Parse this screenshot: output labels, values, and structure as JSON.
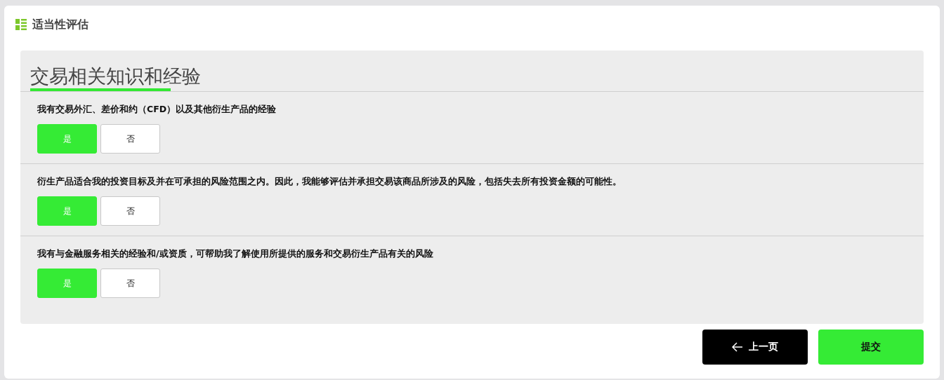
{
  "header": {
    "title": "适当性评估"
  },
  "section": {
    "title": "交易相关知识和经验",
    "questions": [
      {
        "text": "我有交易外汇、差价和约（CFD）以及其他衍生产品的经验",
        "options": [
          {
            "label": "是",
            "selected": true
          },
          {
            "label": "否",
            "selected": false
          }
        ]
      },
      {
        "text": "衍生产品适合我的投资目标及并在可承担的风险范围之内。因此，我能够评估并承担交易该商品所涉及的风险，包括失去所有投资金额的可能性。",
        "options": [
          {
            "label": "是",
            "selected": true
          },
          {
            "label": "否",
            "selected": false
          }
        ]
      },
      {
        "text": "我有与金融服务相关的经验和/或资质，可帮助我了解使用所提供的服务和交易衍生产品有关的风险",
        "options": [
          {
            "label": "是",
            "selected": true
          },
          {
            "label": "否",
            "selected": false
          }
        ]
      }
    ]
  },
  "footer": {
    "back_button": "上一页",
    "submit_button": "提交"
  }
}
